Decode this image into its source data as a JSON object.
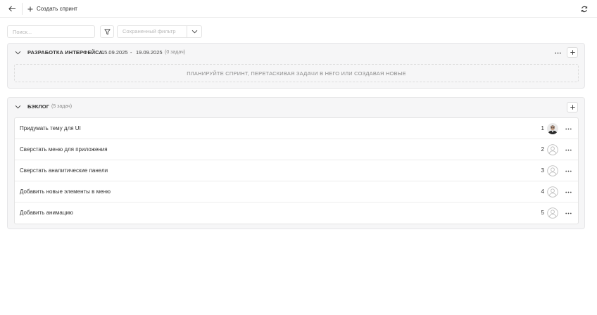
{
  "toolbar": {
    "back_icon": "arrow-left-icon",
    "create_sprint_label": "Создать спринт",
    "refresh_icon": "refresh-icon"
  },
  "filters": {
    "search_placeholder": "Поиск...",
    "filter_icon": "funnel-icon",
    "saved_filter_placeholder": "Сохраненный фильтр"
  },
  "sprint": {
    "title": "РАЗРАБОТКА ИНТЕРФЕЙСА.",
    "start_date": "15.09.2025",
    "date_separator": "-",
    "end_date": "19.09.2025",
    "count_label": "(0 задач)",
    "empty_hint": "ПЛАНИРУЙТЕ СПРИНТ, ПЕРЕТАСКИВАЯ ЗАДАЧИ В НЕГО ИЛИ СОЗДАВАЯ НОВЫЕ"
  },
  "backlog": {
    "title": "БЭКЛОГ",
    "count_label": "(5 задач)",
    "tasks": [
      {
        "title": "Придумать тему для UI",
        "number": "1",
        "avatar": "user-photo"
      },
      {
        "title": "Сверстать меню для приложения",
        "number": "2",
        "avatar": "empty-user-icon"
      },
      {
        "title": "Сверстать аналитические панели",
        "number": "3",
        "avatar": "empty-user-icon"
      },
      {
        "title": "Добавить новые элементы в меню",
        "number": "4",
        "avatar": "empty-user-icon"
      },
      {
        "title": "Добавить анимацию",
        "number": "5",
        "avatar": "empty-user-icon"
      }
    ]
  }
}
